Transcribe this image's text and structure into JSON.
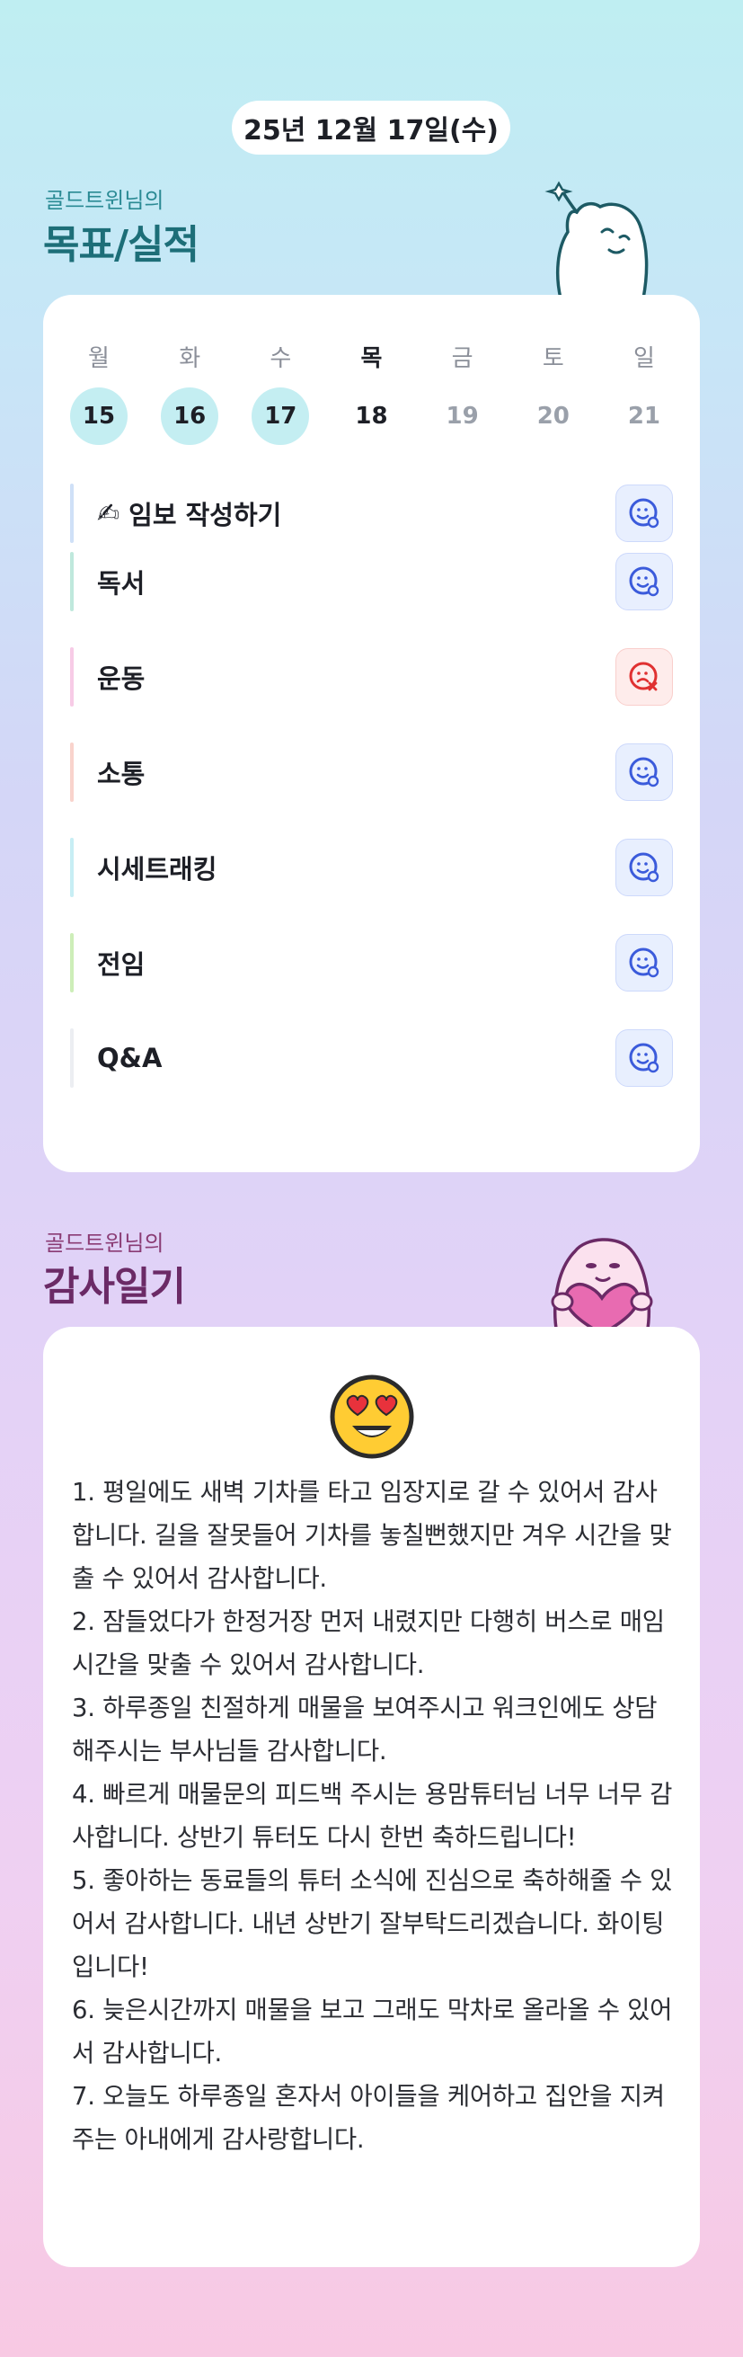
{
  "header": {
    "date": "25년 12월 17일(수)"
  },
  "goals_section": {
    "subtitle": "골드트윈님의",
    "title": "목표/실적"
  },
  "week": {
    "weekdays": [
      "월",
      "화",
      "수",
      "목",
      "금",
      "토",
      "일"
    ],
    "days": [
      {
        "num": "15",
        "state": "done"
      },
      {
        "num": "16",
        "state": "done"
      },
      {
        "num": "17",
        "state": "done"
      },
      {
        "num": "18",
        "state": "today"
      },
      {
        "num": "19",
        "state": "future"
      },
      {
        "num": "20",
        "state": "future"
      },
      {
        "num": "21",
        "state": "future"
      }
    ]
  },
  "goals": [
    {
      "label": "임보 작성하기",
      "icon": "pencil-icon",
      "status": "ok",
      "color": "#cfe0f7"
    },
    {
      "label": "독서",
      "status": "ok",
      "color": "#bfe8dc"
    },
    {
      "label": "운동",
      "status": "fail",
      "color": "#f7cbe6"
    },
    {
      "label": "소통",
      "status": "ok",
      "color": "#f9d3cc"
    },
    {
      "label": "시세트래킹",
      "status": "ok",
      "color": "#c7eef4"
    },
    {
      "label": "전임",
      "status": "ok",
      "color": "#cdeeb8"
    },
    {
      "label": "Q&A",
      "status": "ok",
      "color": "#eceef2"
    }
  ],
  "gratitude_section": {
    "subtitle": "골드트윈님의",
    "title": "감사일기"
  },
  "gratitude": {
    "emoji": "heart-eyes-emoji",
    "text": "1. 평일에도 새벽 기차를 타고 임장지로 갈 수 있어서 감사합니다. 길을 잘못들어 기차를 놓칠뻔했지만 겨우 시간을 맞출 수 있어서 감사합니다.\n2. 잠들었다가 한정거장 먼저 내렸지만 다행히 버스로 매임시간을 맞출 수 있어서 감사합니다.\n3. 하루종일 친절하게 매물을 보여주시고 워크인에도 상담해주시는 부사님들 감사합니다.\n4. 빠르게 매물문의 피드백 주시는 용맘튜터님 너무 너무 감사합니다. 상반기 튜터도 다시 한번 축하드립니다!\n5. 좋아하는 동료들의 튜터 소식에 진심으로 축하해줄 수 있어서 감사합니다. 내년 상반기 잘부탁드리겠습니다. 화이팅입니다!\n6. 늦은시간까지 매물을 보고 그래도 막차로 올라올 수 있어서 감사합니다.\n7. 오늘도 하루종일 혼자서 아이들을 케어하고 집안을 지켜주는 아내에게 감사랑합니다."
  },
  "colors": {
    "accent_teal": "#1d6e78",
    "accent_plum": "#6b2a66",
    "ok_icon": "#3b5bdb",
    "fail_icon": "#e03131"
  }
}
